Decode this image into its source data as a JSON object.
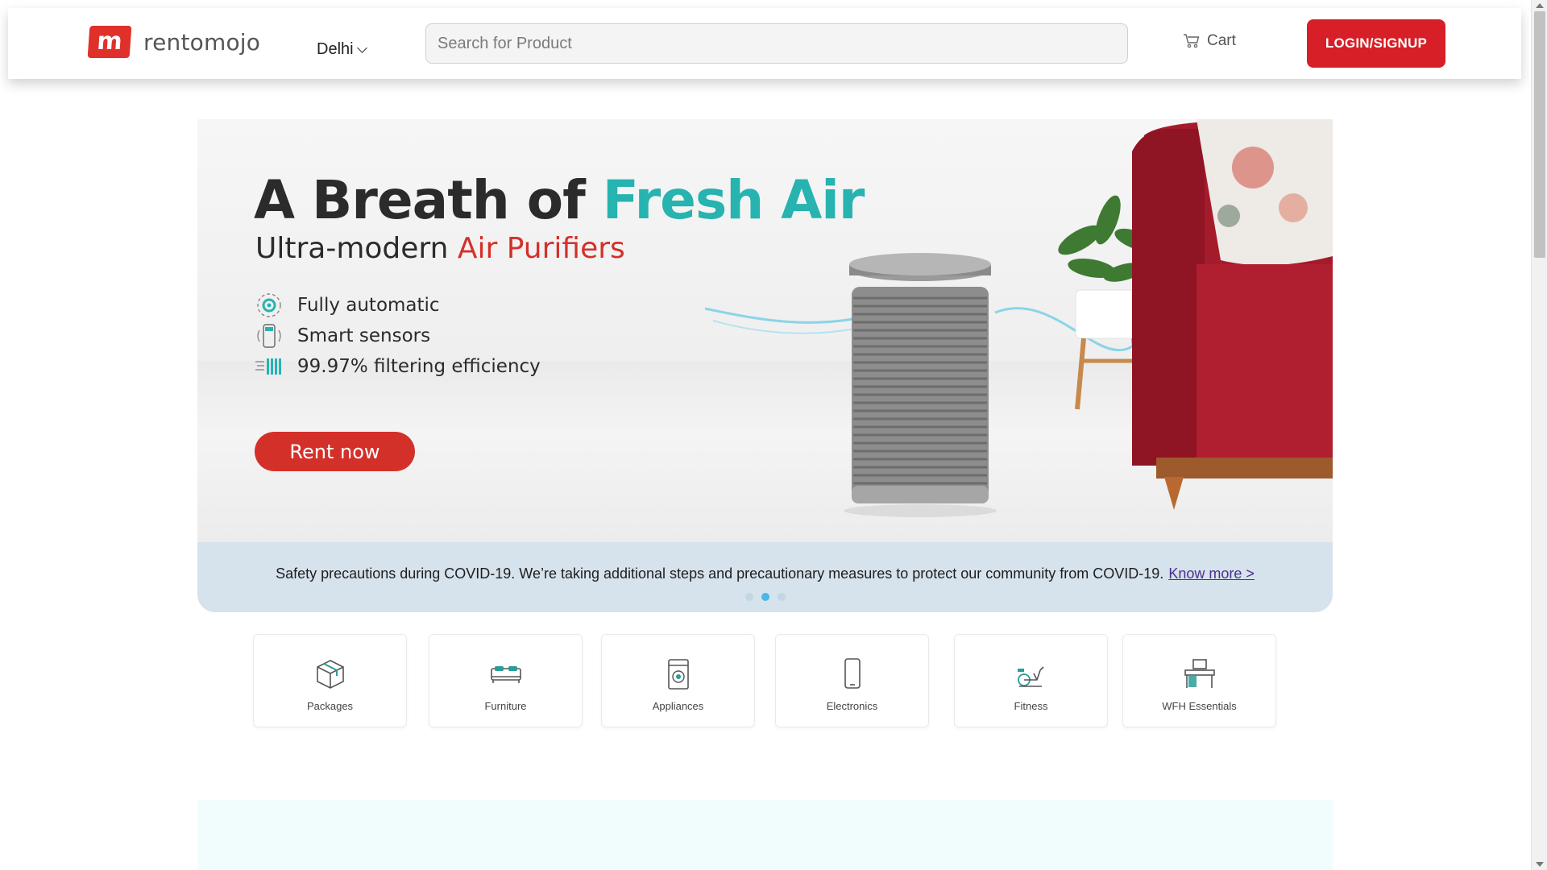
{
  "header": {
    "logo_mark": "m",
    "logo_text": "rentomojo",
    "city": "Delhi",
    "search_placeholder": "Search for Product",
    "cart_label": "Cart",
    "login_label": "LOGIN/SIGNUP"
  },
  "banner": {
    "title_prefix": "A Breath of ",
    "title_accent": "Fresh Air",
    "subtitle_prefix": "Ultra-modern ",
    "subtitle_accent": "Air Purifiers",
    "features": [
      {
        "label": "Fully automatic",
        "icon": "gear-icon"
      },
      {
        "label": "Smart sensors",
        "icon": "sensor-icon"
      },
      {
        "label": "99.97% filtering efficiency",
        "icon": "filter-icon"
      }
    ],
    "cta_label": "Rent now",
    "colors": {
      "accent_teal": "#27b3b0",
      "accent_red": "#d4302a"
    }
  },
  "notice": {
    "text": "Safety precautions during COVID-19. We’re taking additional steps and precautionary measures to protect our community from COVID-19.",
    "link_label": "Know more >",
    "carousel_active_index": 1,
    "carousel_count": 3
  },
  "categories": [
    {
      "label": "Packages",
      "icon": "package-icon"
    },
    {
      "label": "Furniture",
      "icon": "bed-icon"
    },
    {
      "label": "Appliances",
      "icon": "washing-machine-icon"
    },
    {
      "label": "Electronics",
      "icon": "phone-icon"
    },
    {
      "label": "Fitness",
      "icon": "exercise-bike-icon"
    },
    {
      "label": "WFH Essentials",
      "icon": "desk-chair-icon"
    }
  ],
  "colors": {
    "brand_red": "#d61f26",
    "notice_bg": "#d6e2ec",
    "icon_teal": "#2a9c9a"
  }
}
